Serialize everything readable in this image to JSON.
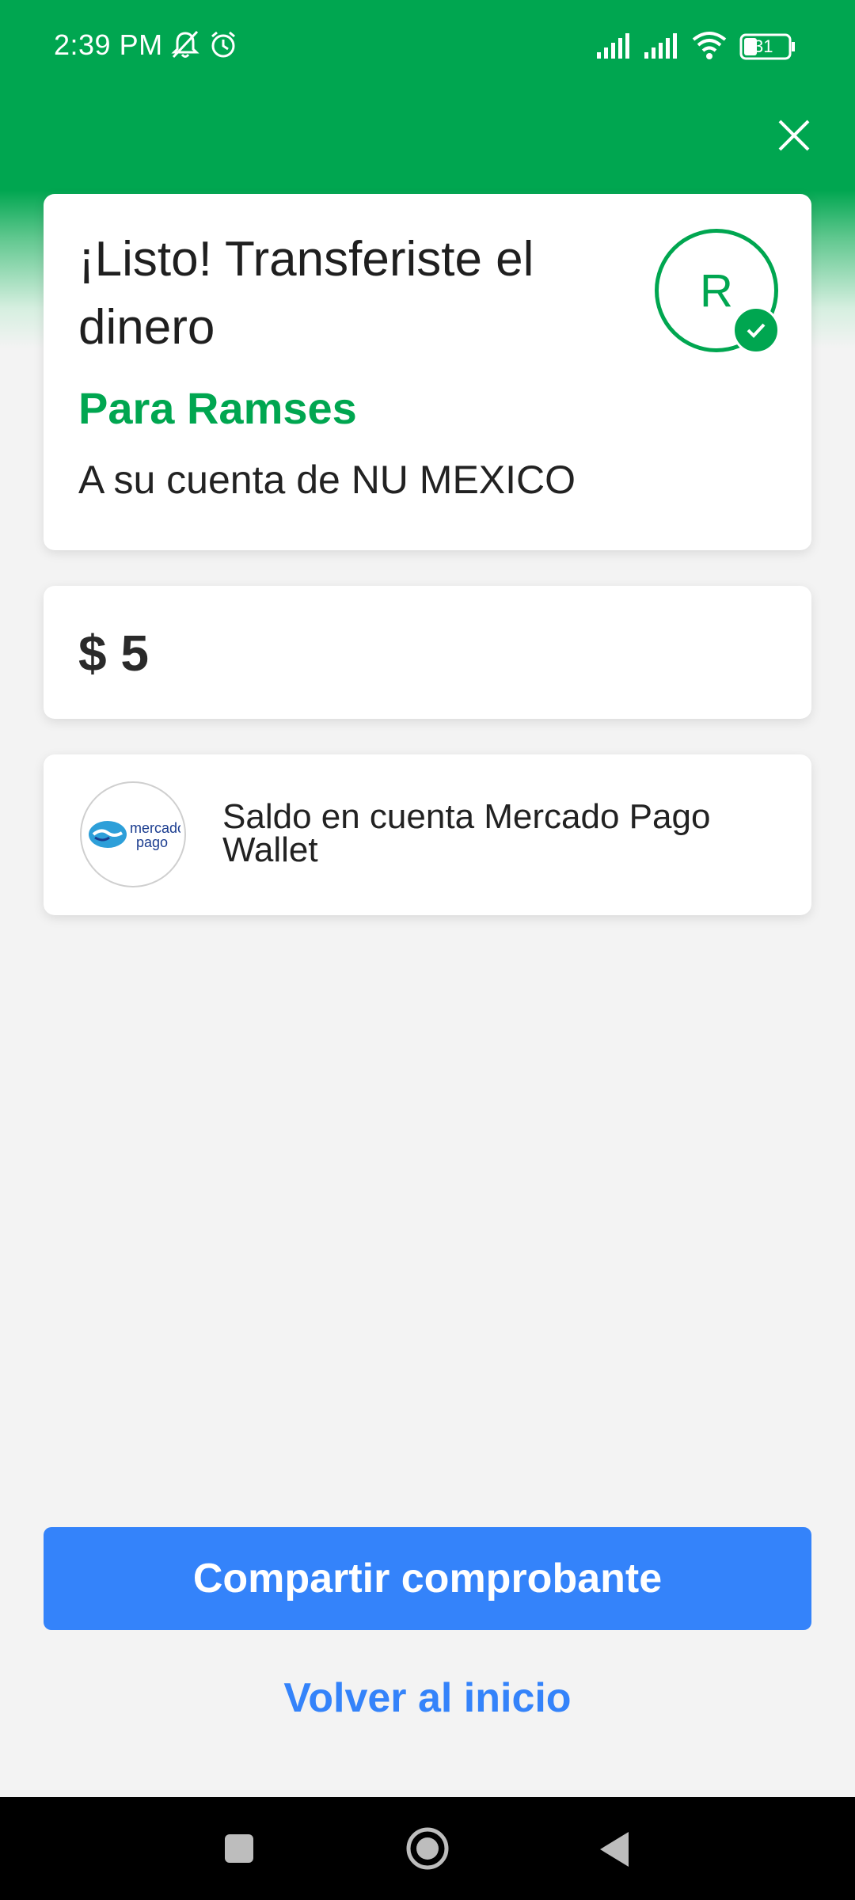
{
  "status_bar": {
    "time": "2:39 PM",
    "battery": "31",
    "icons": [
      "bell-muted-icon",
      "alarm-icon",
      "signal-icon",
      "signal-icon",
      "wifi-icon",
      "battery-icon"
    ]
  },
  "header": {
    "close_icon": "close-icon"
  },
  "success_card": {
    "title": "¡Listo! Transferiste el dinero",
    "recipient": "Para Ramses",
    "account": "A su cuenta de NU MEXICO",
    "avatar_initial": "R"
  },
  "amount_card": {
    "amount": "$ 5"
  },
  "method_card": {
    "logo_line1": "mercado",
    "logo_line2": "pago",
    "text": "Saldo en cuenta Mercado Pago Wallet"
  },
  "actions": {
    "share_label": "Compartir comprobante",
    "home_label": "Volver al inicio"
  },
  "colors": {
    "brand_green": "#00a650",
    "accent_blue": "#3483fa",
    "background": "#f3f3f3"
  }
}
